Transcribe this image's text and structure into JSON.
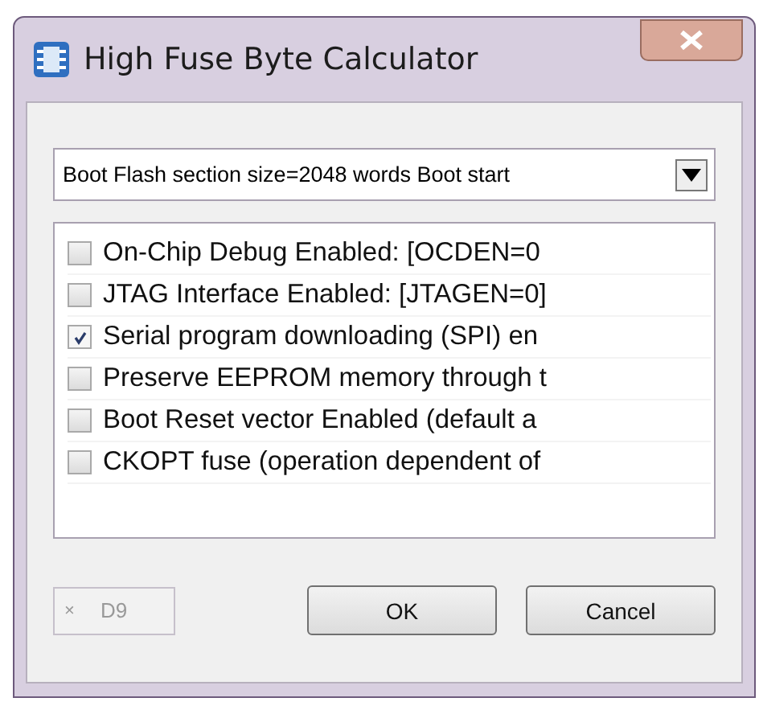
{
  "window": {
    "title": "High Fuse Byte Calculator"
  },
  "dropdown": {
    "value": "Boot Flash section size=2048 words Boot start"
  },
  "options": [
    {
      "label": "On-Chip Debug Enabled: [OCDEN=0",
      "checked": false
    },
    {
      "label": "JTAG Interface Enabled: [JTAGEN=0]",
      "checked": false
    },
    {
      "label": "Serial program downloading (SPI) en",
      "checked": true
    },
    {
      "label": "Preserve EEPROM memory through t",
      "checked": false
    },
    {
      "label": "Boot Reset vector Enabled (default a",
      "checked": false
    },
    {
      "label": "CKOPT fuse (operation dependent of",
      "checked": false
    }
  ],
  "hex_field": {
    "prefix": "×",
    "value": "D9",
    "disabled": true
  },
  "buttons": [
    "OK",
    "Cancel"
  ]
}
